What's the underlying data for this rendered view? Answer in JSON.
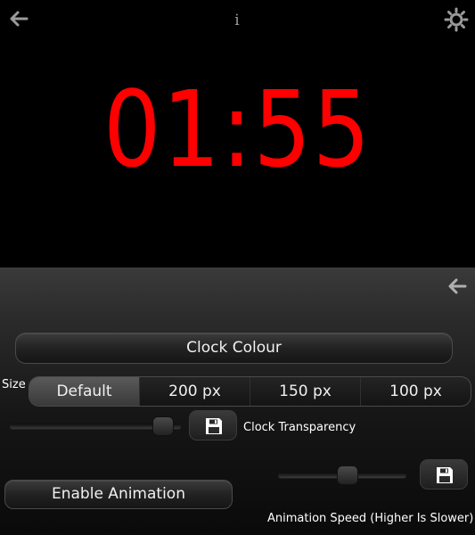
{
  "clock": {
    "time": "01:55",
    "color": "#ff0000"
  },
  "header": {
    "info_glyph": "i",
    "back_icon": "back-arrow-icon",
    "settings_icon": "gear-icon"
  },
  "settings": {
    "back_icon": "back-arrow-icon",
    "clock_colour_label": "Clock Colour",
    "size_label": "Size",
    "size_options": [
      "Default",
      "200 px",
      "150 px",
      "100 px"
    ],
    "size_selected": "Default",
    "transparency_label": "Clock Transparency",
    "transparency_value": 0.95,
    "save_icon": "floppy-disk-icon",
    "enable_animation_label": "Enable Animation",
    "animation_speed_label": "Animation Speed (Higher Is Slower)",
    "animation_speed_value": 0.55
  }
}
